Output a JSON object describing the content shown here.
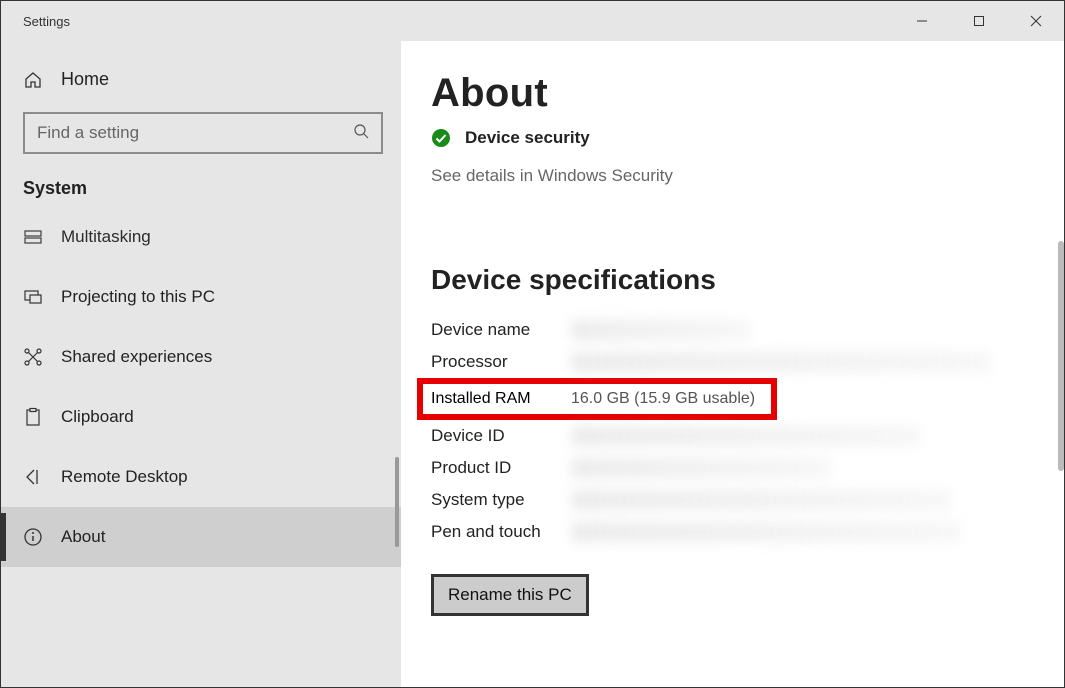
{
  "window": {
    "title": "Settings"
  },
  "sidebar": {
    "home": "Home",
    "search_placeholder": "Find a setting",
    "section": "System",
    "items": [
      {
        "label": "Multitasking"
      },
      {
        "label": "Projecting to this PC"
      },
      {
        "label": "Shared experiences"
      },
      {
        "label": "Clipboard"
      },
      {
        "label": "Remote Desktop"
      },
      {
        "label": "About"
      }
    ]
  },
  "content": {
    "title": "About",
    "security": {
      "label": "Device security",
      "detail": "See details in Windows Security"
    },
    "specs_heading": "Device specifications",
    "specs": {
      "device_name": "Device name",
      "processor": "Processor",
      "installed_ram": "Installed RAM",
      "installed_ram_value": "16.0 GB (15.9 GB usable)",
      "device_id": "Device ID",
      "product_id": "Product ID",
      "system_type": "System type",
      "pen_touch": "Pen and touch"
    },
    "rename_button": "Rename this PC"
  }
}
